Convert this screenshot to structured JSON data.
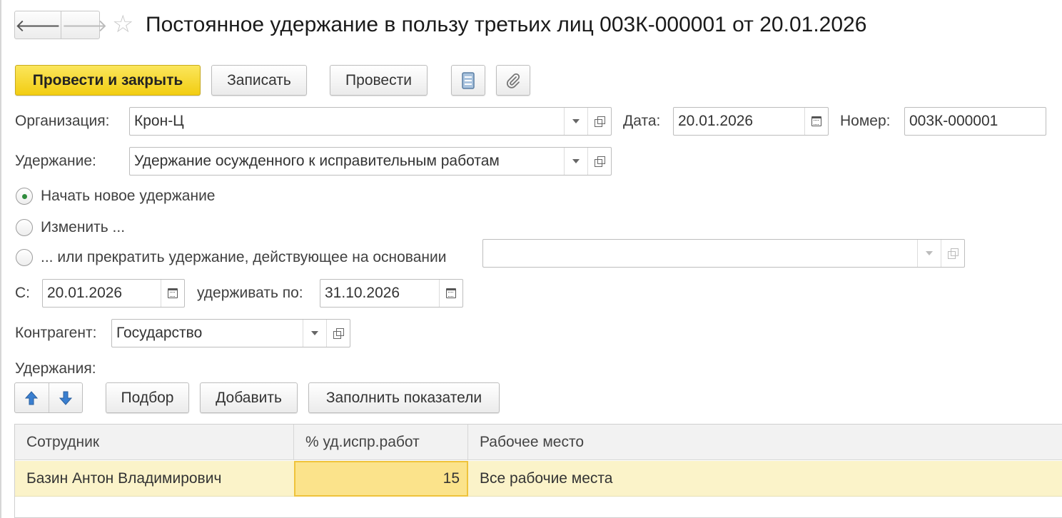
{
  "header": {
    "title": "Постоянное удержание в пользу третьих лиц 003К-000001 от 20.01.2026",
    "back_glyph": "🡐",
    "forward_glyph": "🡒",
    "star_glyph": "☆"
  },
  "toolbar": {
    "post_close_label": "Провести и закрыть",
    "save_label": "Записать",
    "post_label": "Провести"
  },
  "form": {
    "organization": {
      "label": "Организация:",
      "value": "Крон-Ц"
    },
    "date": {
      "label": "Дата:",
      "value": "20.01.2026"
    },
    "number": {
      "label": "Номер:",
      "value": "003К-000001"
    },
    "deduction": {
      "label": "Удержание:",
      "value": "Удержание осужденного к исправительным работам"
    },
    "radio_options": [
      {
        "label": "Начать новое удержание",
        "selected": true
      },
      {
        "label": "Изменить ...",
        "selected": false
      },
      {
        "label": "... или прекратить удержание, действующее на основании",
        "selected": false
      }
    ],
    "basis_value": "",
    "from": {
      "label": "С:",
      "value": "20.01.2026"
    },
    "until": {
      "label": "удерживать по:",
      "value": "31.10.2026"
    },
    "counterparty": {
      "label": "Контрагент:",
      "value": "Государство"
    }
  },
  "deductions": {
    "section_label": "Удержания:",
    "buttons": {
      "pick_label": "Подбор",
      "add_label": "Добавить",
      "fill_label": "Заполнить показатели"
    },
    "columns": [
      "Сотрудник",
      "% уд.испр.работ",
      "Рабочее место"
    ],
    "rows": [
      {
        "employee": "Базин Антон Владимирович",
        "percent": "15",
        "workplace": "Все рабочие места"
      }
    ]
  },
  "colors": {
    "primary_button": "#f2cd12",
    "selected_row": "#fbf3c9",
    "active_cell": "#fbe38b",
    "radio_dot": "#2e8b3c",
    "arrow_blue": "#3a7fd0"
  }
}
